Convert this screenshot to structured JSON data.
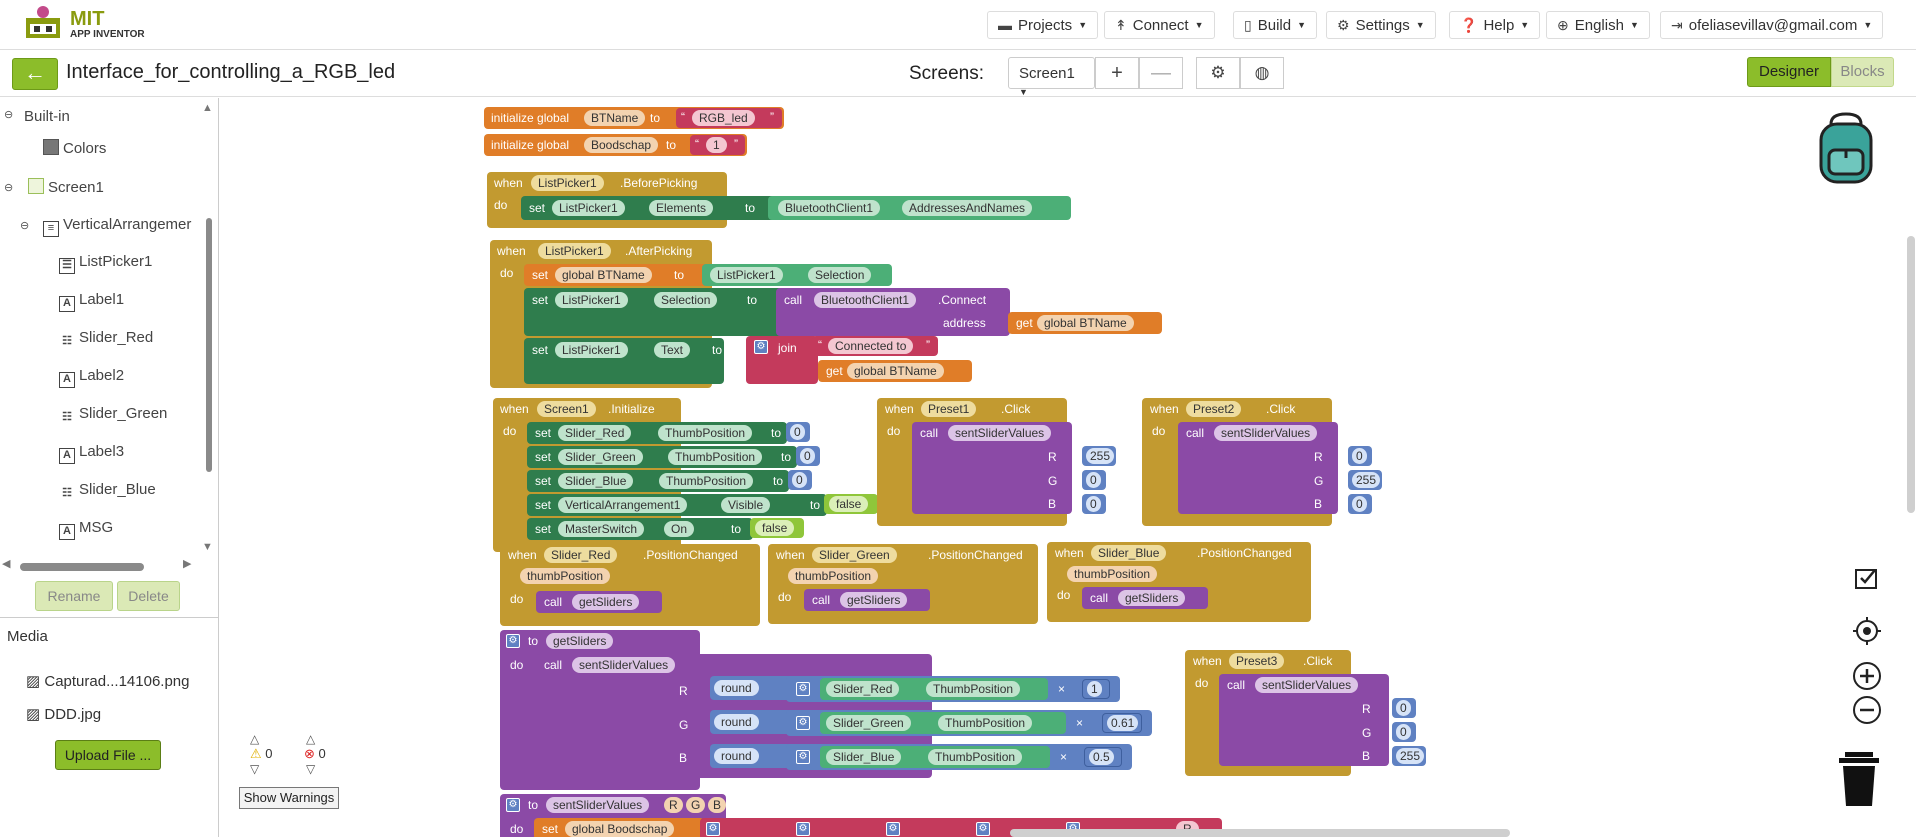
{
  "app": {
    "brand_main": "MIT",
    "brand_sub": "APP INVENTOR",
    "accent": "#8cbd2a"
  },
  "menu": {
    "projects": "Projects",
    "connect": "Connect",
    "build": "Build",
    "settings": "Settings",
    "help": "Help",
    "language": "English",
    "account": "ofeliasevillav@gmail.com"
  },
  "project": {
    "name": "Interface_for_controlling_a_RGB_led",
    "screens_label": "Screens:",
    "screen_selected": "Screen1",
    "designer_label": "Designer",
    "blocks_label": "Blocks"
  },
  "tree": {
    "builtin": "Built-in",
    "colors": "Colors",
    "screen": "Screen1",
    "arrangement": "VerticalArrangemer",
    "items": [
      "ListPicker1",
      "Label1",
      "Slider_Red",
      "Label2",
      "Slider_Green",
      "Label3",
      "Slider_Blue",
      "MSG"
    ],
    "rename": "Rename",
    "delete": "Delete"
  },
  "media": {
    "title": "Media",
    "files": [
      "Capturad...14106.png",
      "DDD.jpg"
    ],
    "upload": "Upload File ..."
  },
  "warnings": {
    "warn_count": "0",
    "error_count": "0",
    "show_label": "Show Warnings"
  },
  "blocks": {
    "init": "initialize global",
    "to": "to",
    "when": "when",
    "do": "do",
    "set": "set",
    "call": "call",
    "get": "get",
    "join": "join",
    "round": "round",
    "address": "address",
    "times": "×",
    "global1_name": "BTName",
    "global1_value": "RGB_led",
    "global2_name": "Boodschap",
    "global2_value": "1",
    "listpicker": "ListPicker1",
    "before_picking": ".BeforePicking",
    "after_picking": ".AfterPicking",
    "elements": "Elements",
    "bt": "BluetoothClient1",
    "addresses": "AddressesAndNames",
    "global_btname": "global BTName",
    "selection": "Selection",
    "connect_method": ".Connect",
    "text": "Text",
    "connected_to": "Connected to",
    "screen1": "Screen1",
    "initialize": ".Initialize",
    "thumb": "ThumbPosition",
    "slider_red": "Slider_Red",
    "slider_green": "Slider_Green",
    "slider_blue": "Slider_Blue",
    "varr": "VerticalArrangement1",
    "visible": "Visible",
    "master": "MasterSwitch",
    "on": "On",
    "false": "false",
    "zero": "0",
    "v255": "255",
    "preset1": "Preset1",
    "preset2": "Preset2",
    "preset3": "Preset3",
    "click": ".Click",
    "sent": "sentSliderValues",
    "get_sliders": "getSliders",
    "pos_changed": ".PositionChanged",
    "thumb_param": "thumbPosition",
    "R": "R",
    "G": "G",
    "B": "B",
    "one": "1",
    "k061": "0.61",
    "k05": "0.5",
    "boodschap_partial": "global Boodschap",
    "str_r_partial": "R"
  }
}
